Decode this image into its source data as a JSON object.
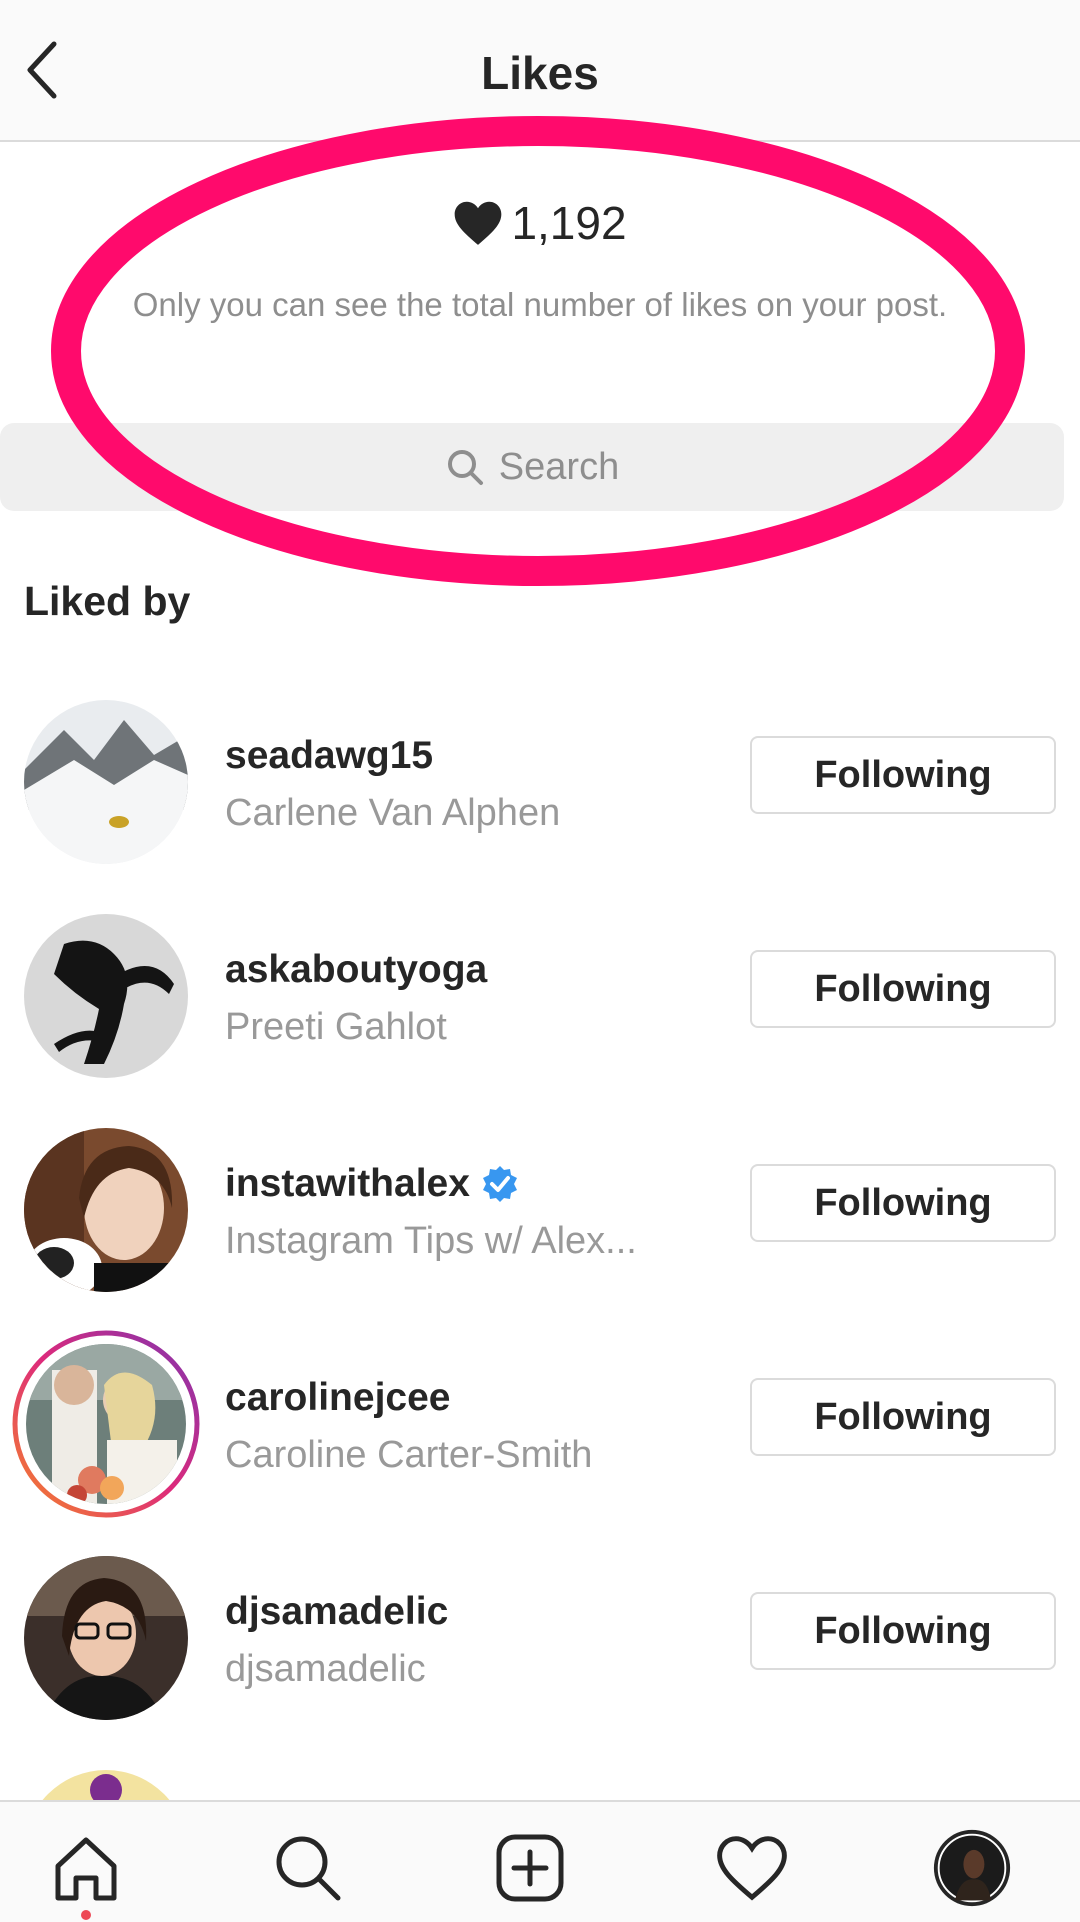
{
  "header": {
    "title": "Likes"
  },
  "likes": {
    "count": "1,192",
    "note": "Only you can see the total number of likes on your post."
  },
  "search": {
    "placeholder": "Search"
  },
  "section": {
    "liked_by": "Liked by"
  },
  "users": [
    {
      "username": "seadawg15",
      "name": "Carlene Van Alphen",
      "button": "Following"
    },
    {
      "username": "askaboutyoga",
      "name": "Preeti Gahlot",
      "button": "Following"
    },
    {
      "username": "instawithalex",
      "name": "Instagram Tips w/ Alex...",
      "button": "Following",
      "verified": true
    },
    {
      "username": "carolinejcee",
      "name": "Caroline Carter-Smith",
      "button": "Following",
      "story": true
    },
    {
      "username": "djsamadelic",
      "name": "djsamadelic",
      "button": "Following"
    }
  ],
  "tabbar": {
    "items": [
      "home-icon",
      "search-icon",
      "add-post-icon",
      "activity-heart-icon",
      "profile-avatar"
    ]
  },
  "colors": {
    "highlight": "#ff0a6c",
    "verified": "#3897f0",
    "notification_dot": "#ed4956"
  }
}
